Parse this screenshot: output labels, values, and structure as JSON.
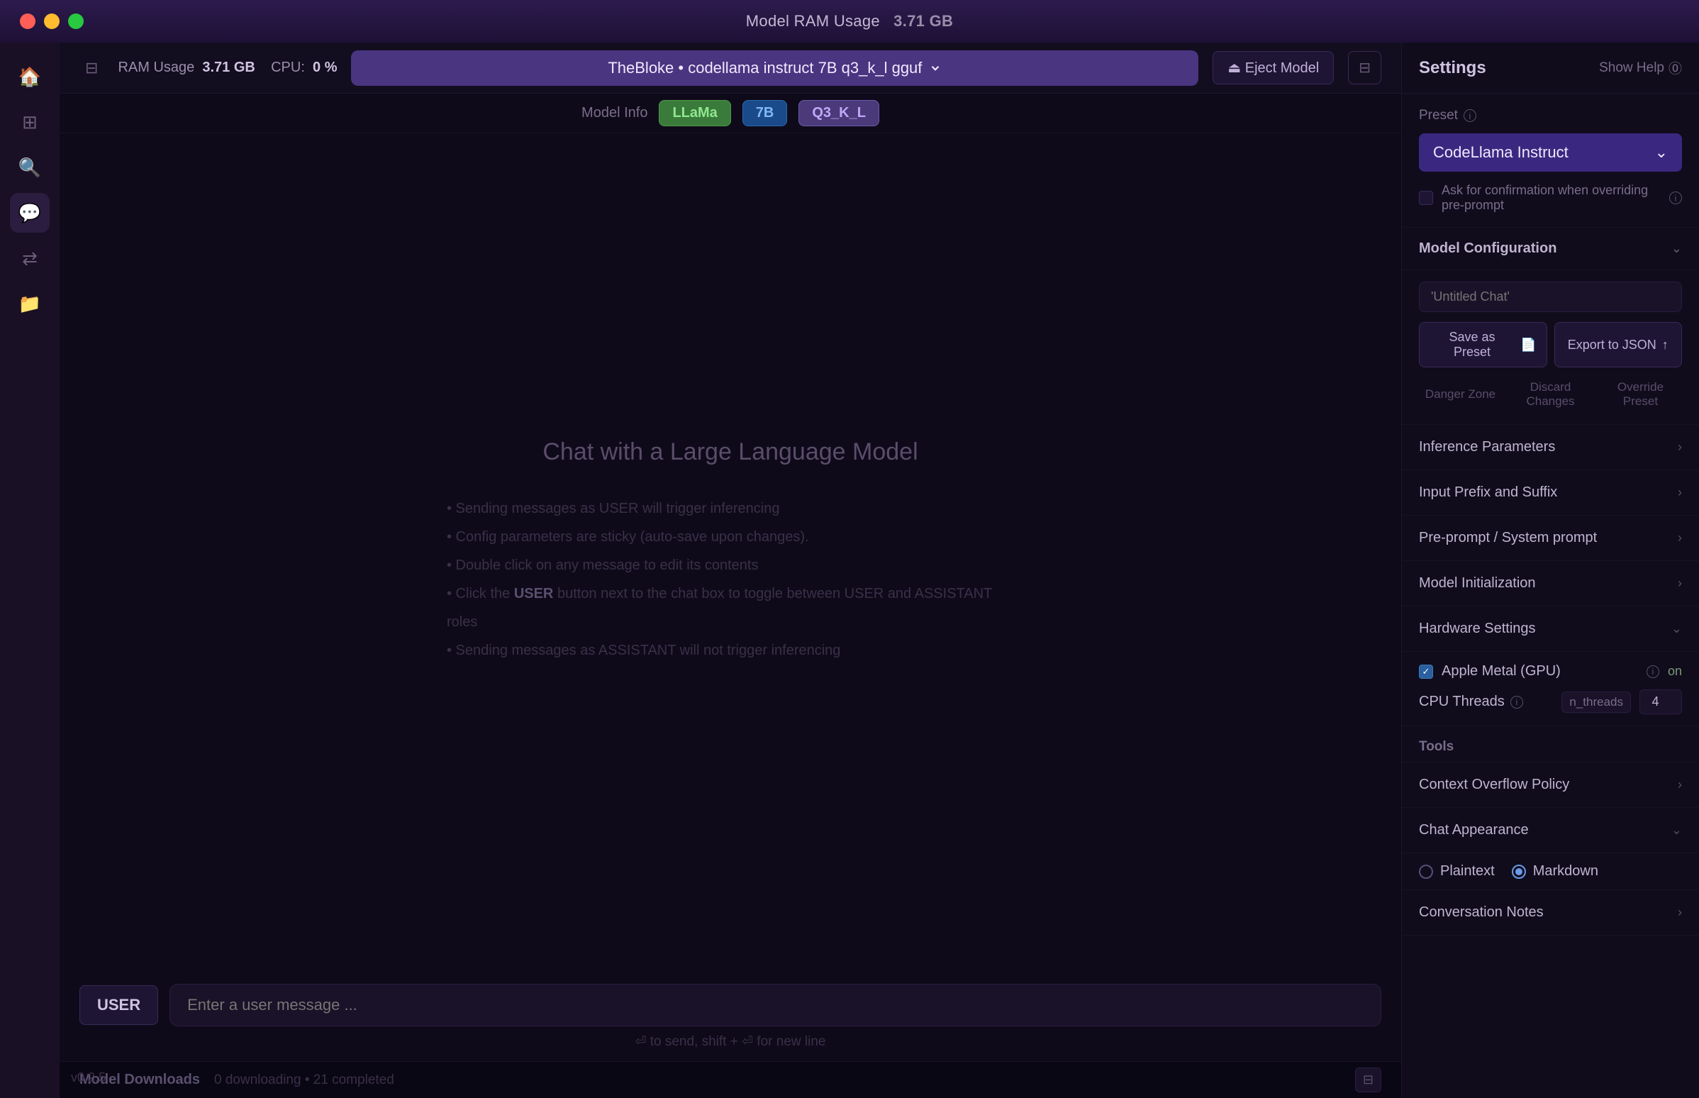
{
  "titleBar": {
    "title": "Model RAM Usage",
    "ramValue": "3.71 GB"
  },
  "topBar": {
    "ramLabel": "RAM Usage",
    "ramValue": "3.71 GB",
    "cpuLabel": "CPU:",
    "cpuValue": "0 %",
    "modelName": "TheBloke • codellama instruct 7B q3_k_l gguf",
    "ejectLabel": "⏏ Eject Model"
  },
  "modelInfo": {
    "label": "Model Info",
    "tags": [
      "LLaMa",
      "7B",
      "Q3_K_L"
    ]
  },
  "chat": {
    "placeholder_title": "Chat with a Large Language Model",
    "hints": [
      "• Sending messages as USER will trigger inferencing",
      "• Config parameters are sticky (auto-save upon changes).",
      "• Double click on any message to edit its contents",
      "• Click the USER button next to the chat box to toggle between USER and ASSISTANT roles",
      "• Sending messages as ASSISTANT will not trigger inferencing"
    ],
    "user_keyword": "USER"
  },
  "inputArea": {
    "userBadge": "USER",
    "placeholder": "Enter a user message ...",
    "hint": "⏎ to send, shift + ⏎ for new line"
  },
  "bottomBar": {
    "version": "v0.2.5",
    "sectionLabel": "Model Downloads",
    "status": "0 downloading • 21 completed"
  },
  "rightPanel": {
    "title": "Settings",
    "showHelpLabel": "Show Help",
    "preset": {
      "label": "Preset",
      "selectedValue": "CodeLlama Instruct",
      "saveAsPresetLabel": "Save as Preset",
      "exportLabel": "Export to JSON",
      "checkboxLabel": "Ask for confirmation when overriding pre-prompt",
      "configPlaceholder": "'Untitled Chat'"
    },
    "modelConfig": {
      "label": "Model Configuration",
      "dangerZoneLabel": "Danger Zone",
      "discardLabel": "Discard Changes",
      "overrideLabel": "Override Preset"
    },
    "inferenceParams": {
      "label": "Inference Parameters"
    },
    "inputPrefixSuffix": {
      "label": "Input Prefix and Suffix"
    },
    "prePrompt": {
      "label": "Pre-prompt / System prompt"
    },
    "modelInit": {
      "label": "Model Initialization"
    },
    "hardwareSettings": {
      "label": "Hardware Settings",
      "gpuLabel": "Apple Metal (GPU)",
      "gpuStatus": "on",
      "cpuLabel": "CPU Threads",
      "cpuValue": "4",
      "nthreadsTag": "n_threads"
    },
    "tools": {
      "label": "Tools"
    },
    "contextOverflow": {
      "label": "Context Overflow Policy"
    },
    "chatAppearance": {
      "label": "Chat Appearance",
      "options": [
        "Plaintext",
        "Markdown"
      ],
      "selectedOption": "Markdown"
    },
    "conversationNotes": {
      "label": "Conversation Notes"
    }
  }
}
